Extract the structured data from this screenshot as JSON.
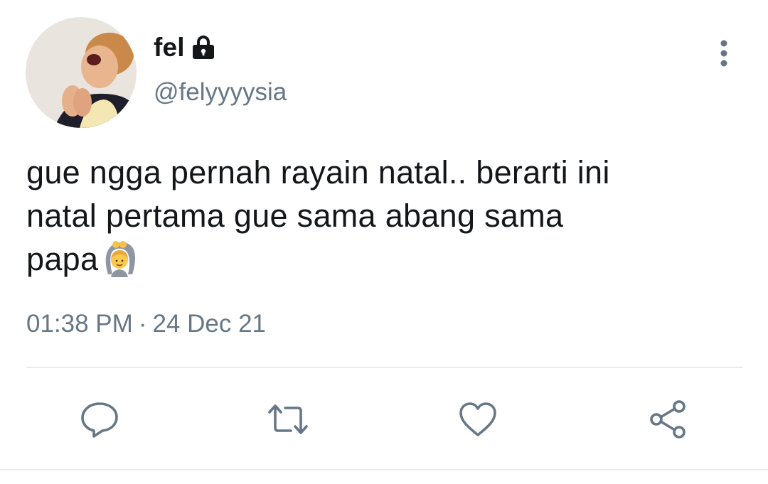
{
  "user": {
    "display_name": "fel",
    "handle": "@felyyyysia",
    "avatar_icon": "avatar-photo",
    "protected_icon": "lock-icon"
  },
  "tweet": {
    "lines": [
      "gue ngga pernah rayain natal.. berarti ini",
      "natal pertama gue sama abang sama",
      "papa"
    ],
    "emoji": "🙆‍♂️",
    "time": "01:38 PM",
    "separator": "·",
    "date": "24 Dec 21"
  },
  "actions": {
    "reply_icon": "reply-icon",
    "retweet_icon": "retweet-icon",
    "like_icon": "heart-icon",
    "share_icon": "share-icon",
    "more_icon": "more-vertical-icon"
  },
  "colors": {
    "text": "#14171a",
    "secondary": "#657786",
    "divider": "#e6ecf0"
  }
}
